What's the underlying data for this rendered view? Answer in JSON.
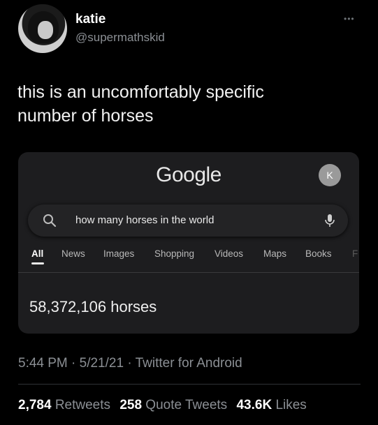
{
  "tweet": {
    "author_name": "katie",
    "author_handle": "@supermathskid",
    "more_icon": "ellipsis-icon",
    "text_line1": "this is an uncomfortably specific",
    "text_line2": "number of horses",
    "timestamp": "5:44 PM · 5/21/21 · Twitter for Android",
    "retweets_count": "2,784",
    "retweets_label": "Retweets",
    "quotes_count": "258",
    "quotes_label": "Quote Tweets",
    "likes_count": "43.6K",
    "likes_label": "Likes"
  },
  "google": {
    "logo": "Google",
    "account_initial": "K",
    "query": "how many horses in the world",
    "tabs": [
      "All",
      "News",
      "Images",
      "Shopping",
      "Videos",
      "Maps",
      "Books",
      "F"
    ],
    "result": "58,372,106 horses"
  },
  "colors": {
    "background": "#000000",
    "card": "#1d1d1f",
    "secondary_text": "#8b8f94"
  }
}
